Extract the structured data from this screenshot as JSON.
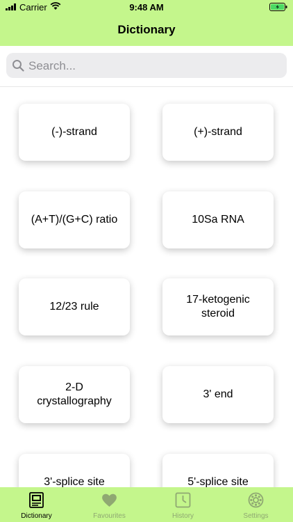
{
  "status_bar": {
    "carrier": "Carrier",
    "time": "9:48 AM"
  },
  "header": {
    "title": "Dictionary"
  },
  "search": {
    "placeholder": "Search..."
  },
  "terms": [
    "(-)-strand",
    "(+)-strand",
    "(A+T)/(G+C) ratio",
    "10Sa RNA",
    "12/23 rule",
    "17-ketogenic steroid",
    "2-D crystallography",
    "3' end",
    "3'-splice site",
    "5'-splice site"
  ],
  "tabs": [
    {
      "label": "Dictionary",
      "icon": "dictionary-icon",
      "active": true
    },
    {
      "label": "Favourites",
      "icon": "heart-icon",
      "active": false
    },
    {
      "label": "History",
      "icon": "clock-icon",
      "active": false
    },
    {
      "label": "Settings",
      "icon": "gear-icon",
      "active": false
    }
  ],
  "colors": {
    "accent": "#c4f68c",
    "inactive_tab": "#8fa872"
  }
}
